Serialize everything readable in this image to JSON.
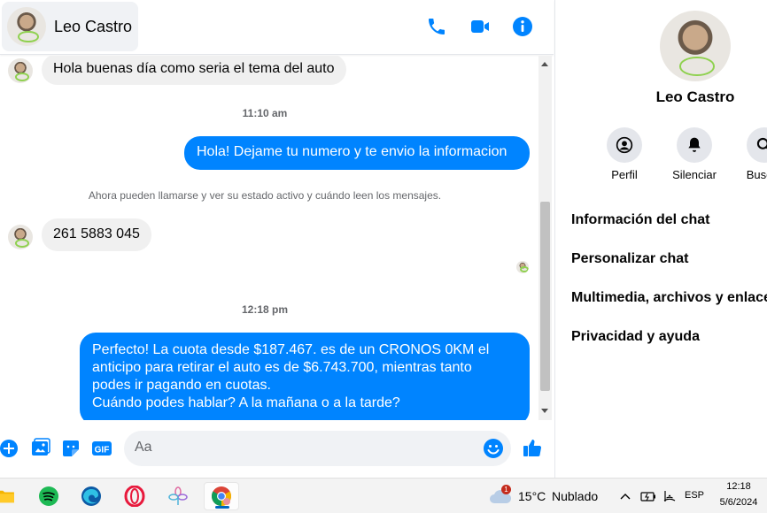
{
  "header": {
    "contact_name": "Leo Castro"
  },
  "messages": {
    "m1": "Hola buenas día como seria el tema del auto",
    "ts1": "11:10 am",
    "m2": "Hola! Dejame tu numero y te envio la informacion",
    "system_note": "Ahora pueden llamarse y ver su estado activo y cuándo leen los mensajes.",
    "m3": "261 5883 045",
    "ts2": "12:18 pm",
    "m4_lines": [
      "Perfecto! La cuota desde $187.467. es de un CRONOS 0KM el",
      "anticipo para retirar el auto es de $6.743.700, mientras tanto",
      "podes ir pagando en cuotas.",
      "Cuándo podes hablar? A la mañana o a la tarde?"
    ]
  },
  "composer": {
    "placeholder": "Aa"
  },
  "info_panel": {
    "name": "Leo Castro",
    "actions": [
      "Perfil",
      "Silenciar",
      "Buscar"
    ],
    "menu": [
      "Información del chat",
      "Personalizar chat",
      "Multimedia, archivos y enlaces",
      "Privacidad y ayuda"
    ]
  },
  "taskbar": {
    "weather_badge": "1",
    "temperature": "15°C",
    "weather": "Nublado",
    "language": "ESP",
    "time": "12:18",
    "date": "5/6/2024"
  },
  "colors": {
    "accent": "#0084ff",
    "incoming_bubble": "#f0f0f0"
  }
}
